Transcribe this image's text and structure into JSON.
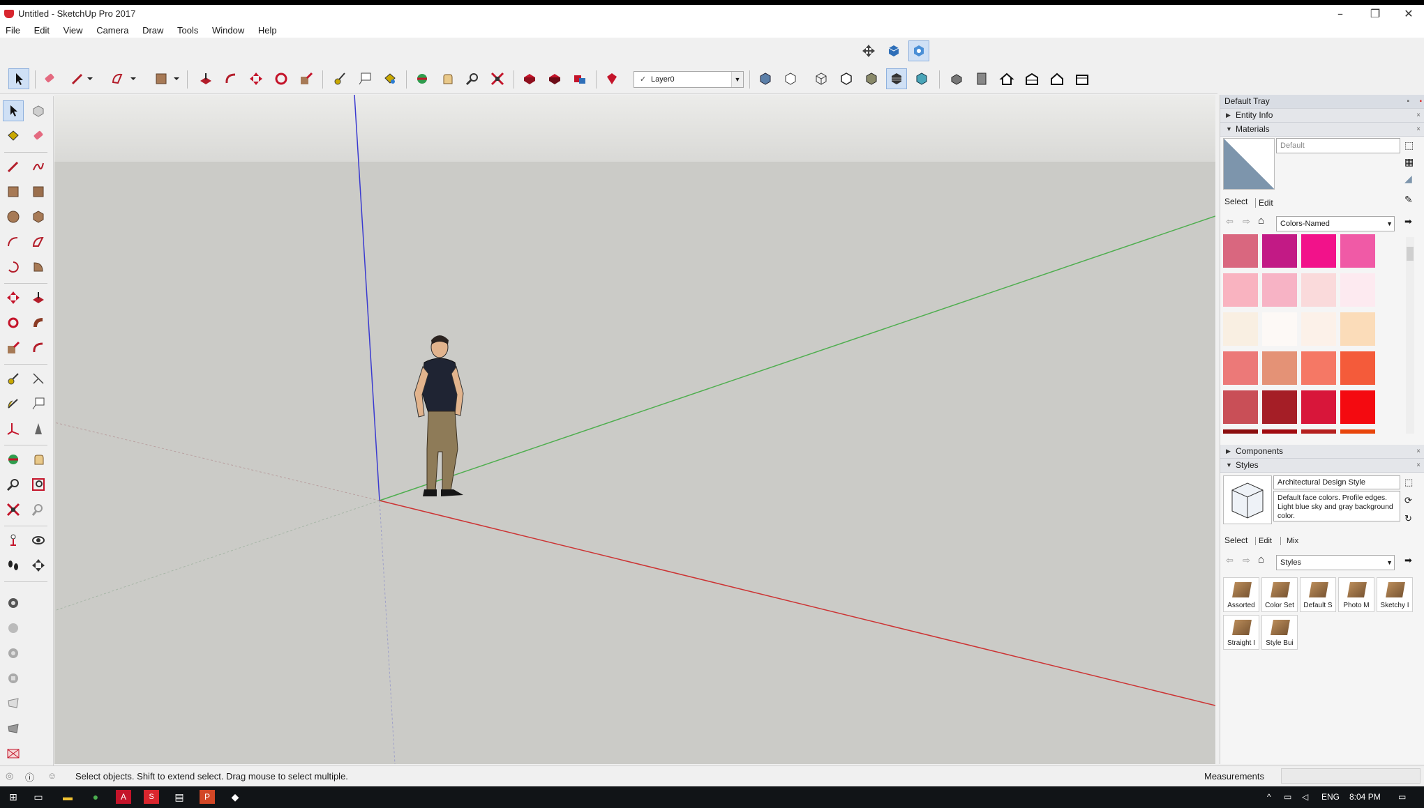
{
  "window": {
    "title": "Untitled - SketchUp Pro 2017",
    "minimize": "–",
    "restore": "❐",
    "close": "✕"
  },
  "menu": [
    "File",
    "Edit",
    "View",
    "Camera",
    "Draw",
    "Tools",
    "Window",
    "Help"
  ],
  "layer": {
    "value": "Layer0",
    "check": "✓"
  },
  "tray": {
    "title": "Default Tray",
    "entity_info": "Entity Info",
    "materials": {
      "header": "Materials",
      "name_value": "Default",
      "tabs": [
        "Select",
        "Edit"
      ],
      "library": "Colors-Named",
      "swatches": [
        "#d9677f",
        "#c21a85",
        "#f2128a",
        "#f05aa6",
        "#f9b3c0",
        "#f7b3c5",
        "#fadadb",
        "#fdeaf0",
        "#f9efe2",
        "#fdf9f6",
        "#fcf1e9",
        "#fbdcb9",
        "#ec7978",
        "#e49276",
        "#f57865",
        "#f45b3a",
        "#c94f57",
        "#a51e26",
        "#d8163a",
        "#f40a10",
        "#8b0e0e",
        "#a10b10",
        "#b5201f",
        "#e8450b"
      ]
    },
    "components": "Components",
    "styles": {
      "header": "Styles",
      "name": "Architectural Design Style",
      "description": "Default face colors. Profile edges. Light blue sky and gray background color.",
      "tabs": [
        "Select",
        "Edit",
        "Mix"
      ],
      "library": "Styles",
      "folders": [
        "Assorted",
        "Color Set",
        "Default S",
        "Photo M",
        "Sketchy I",
        "Straight I",
        "Style Bui"
      ]
    }
  },
  "status": {
    "message": "Select objects. Shift to extend select. Drag mouse to select multiple.",
    "measurements_label": "Measurements"
  },
  "taskbar": {
    "lang": "ENG",
    "time": "8:04 PM"
  },
  "colors": {
    "axis_blue": "#3a3ad0",
    "axis_green": "#4fae4f",
    "axis_red": "#cc3434",
    "viewport_ground": "#cbcbc7"
  }
}
